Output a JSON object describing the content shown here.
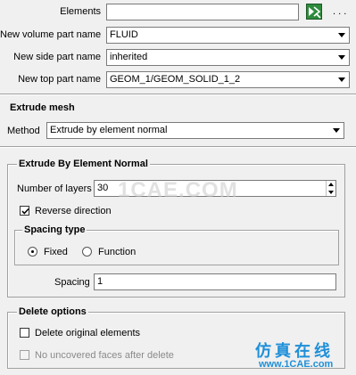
{
  "parts": {
    "elements_label": "Elements",
    "elements_value": "",
    "more_label": ". . .",
    "volume_label": "New volume part name",
    "volume_value": "FLUID",
    "side_label": "New side part name",
    "side_value": "inherited",
    "top_label": "New top part name",
    "top_value": "GEOM_1/GEOM_SOLID_1_2"
  },
  "extrude_mesh": {
    "title": "Extrude mesh",
    "method_label": "Method",
    "method_value": "Extrude by element normal"
  },
  "element_normal": {
    "title": "Extrude By Element Normal",
    "layers_label": "Number of layers",
    "layers_value": "30",
    "reverse_label": "Reverse direction",
    "reverse_checked": true,
    "spacing_type": {
      "title": "Spacing type",
      "fixed_label": "Fixed",
      "function_label": "Function",
      "selected": "Fixed"
    },
    "spacing_label": "Spacing",
    "spacing_value": "1"
  },
  "delete_options": {
    "title": "Delete options",
    "delete_original_label": "Delete original elements",
    "delete_original_checked": false,
    "no_uncovered_label": "No uncovered faces after delete",
    "no_uncovered_checked": false,
    "no_uncovered_enabled": false
  },
  "watermark": {
    "text": "1CAE.COM",
    "logo_cn": "仿真在线",
    "logo_url": "www.1CAE.com"
  },
  "colors": {
    "background": "#f0f0f0",
    "watermark_logo": "#1e8fd8",
    "select_icon": "#2e8b3c"
  }
}
